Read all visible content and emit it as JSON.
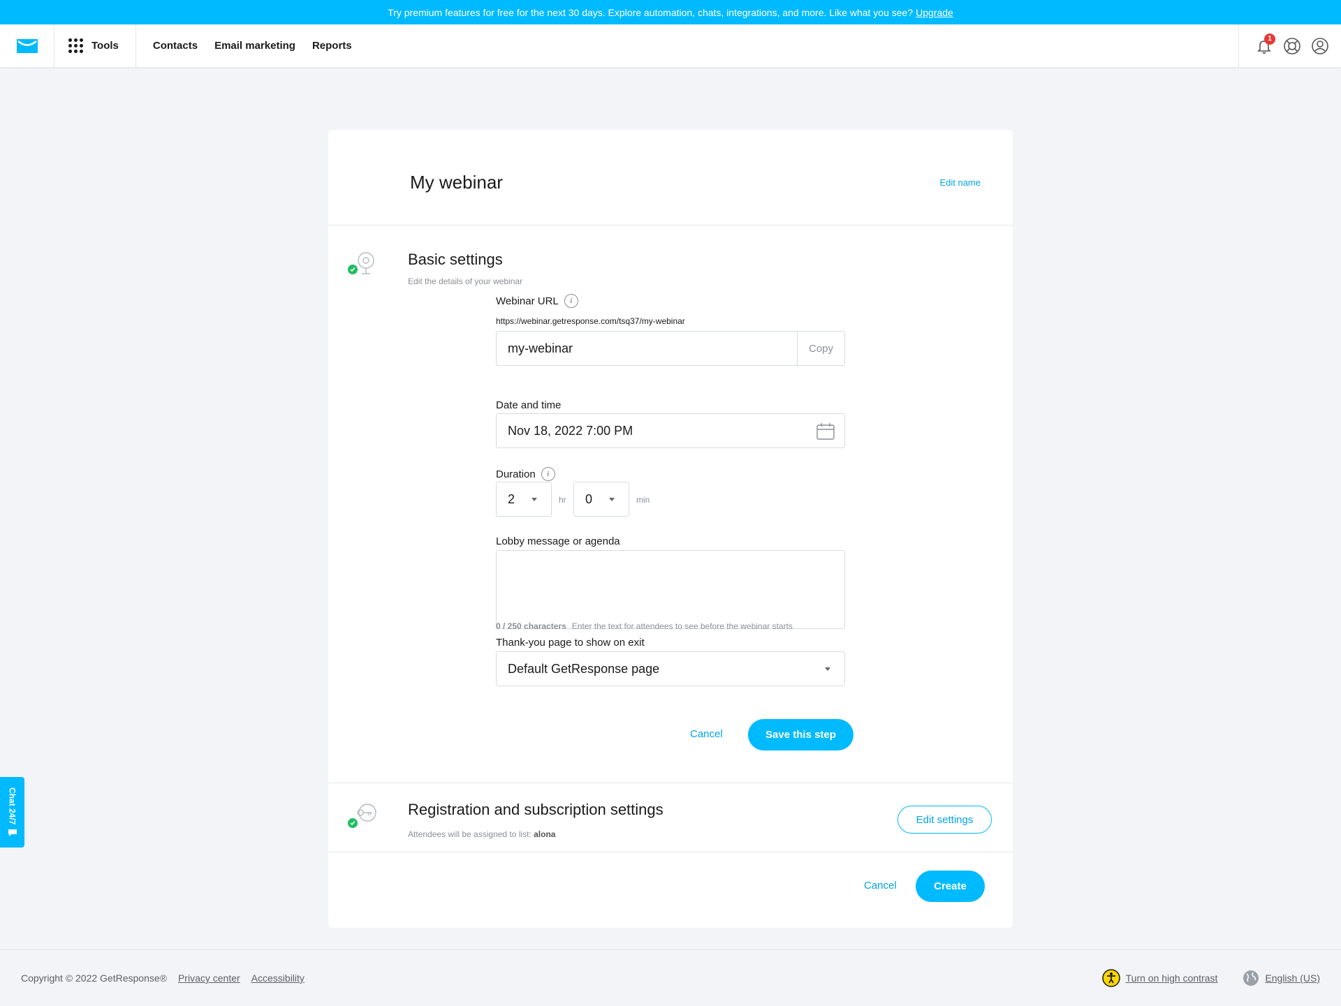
{
  "banner": {
    "text": "Try premium features for free for the next 30 days. Explore automation, chats, integrations, and more. Like what you see?",
    "link": "Upgrade"
  },
  "nav": {
    "tools": "Tools",
    "links": [
      "Contacts",
      "Email marketing",
      "Reports"
    ],
    "notification_count": "1"
  },
  "card": {
    "title": "My webinar",
    "edit_name": "Edit name"
  },
  "basic": {
    "title": "Basic settings",
    "subtitle": "Edit the details of your webinar",
    "url_label": "Webinar URL",
    "url_hint": "https://webinar.getresponse.com/tsq37/my-webinar",
    "url_value": "my-webinar",
    "copy": "Copy",
    "date_label": "Date and time",
    "date_value": "Nov 18, 2022 7:00 PM",
    "duration_label": "Duration",
    "hours": "2",
    "hr_unit": "hr",
    "minutes": "0",
    "min_unit": "min",
    "lobby_label": "Lobby message or agenda",
    "char_count": "0 / 250 characters",
    "lobby_hint": "Enter the text for attendees to see before the webinar starts",
    "thankyou_label": "Thank-you page to show on exit",
    "thankyou_value": "Default GetResponse page",
    "cancel": "Cancel",
    "save": "Save this step"
  },
  "registration": {
    "title": "Registration and subscription settings",
    "subtitle": "Attendees will be assigned to list:",
    "list_name": "alona",
    "edit": "Edit settings"
  },
  "footer_actions": {
    "cancel": "Cancel",
    "create": "Create"
  },
  "chat": {
    "label": "Chat 24/7"
  },
  "footer": {
    "copyright": "Copyright © 2022 GetResponse®",
    "privacy": "Privacy center",
    "accessibility": "Accessibility",
    "contrast": "Turn on high contrast",
    "language": "English (US)"
  },
  "colors": {
    "accent": "#00baff",
    "success": "#1fbd62",
    "badge": "#e53935"
  }
}
